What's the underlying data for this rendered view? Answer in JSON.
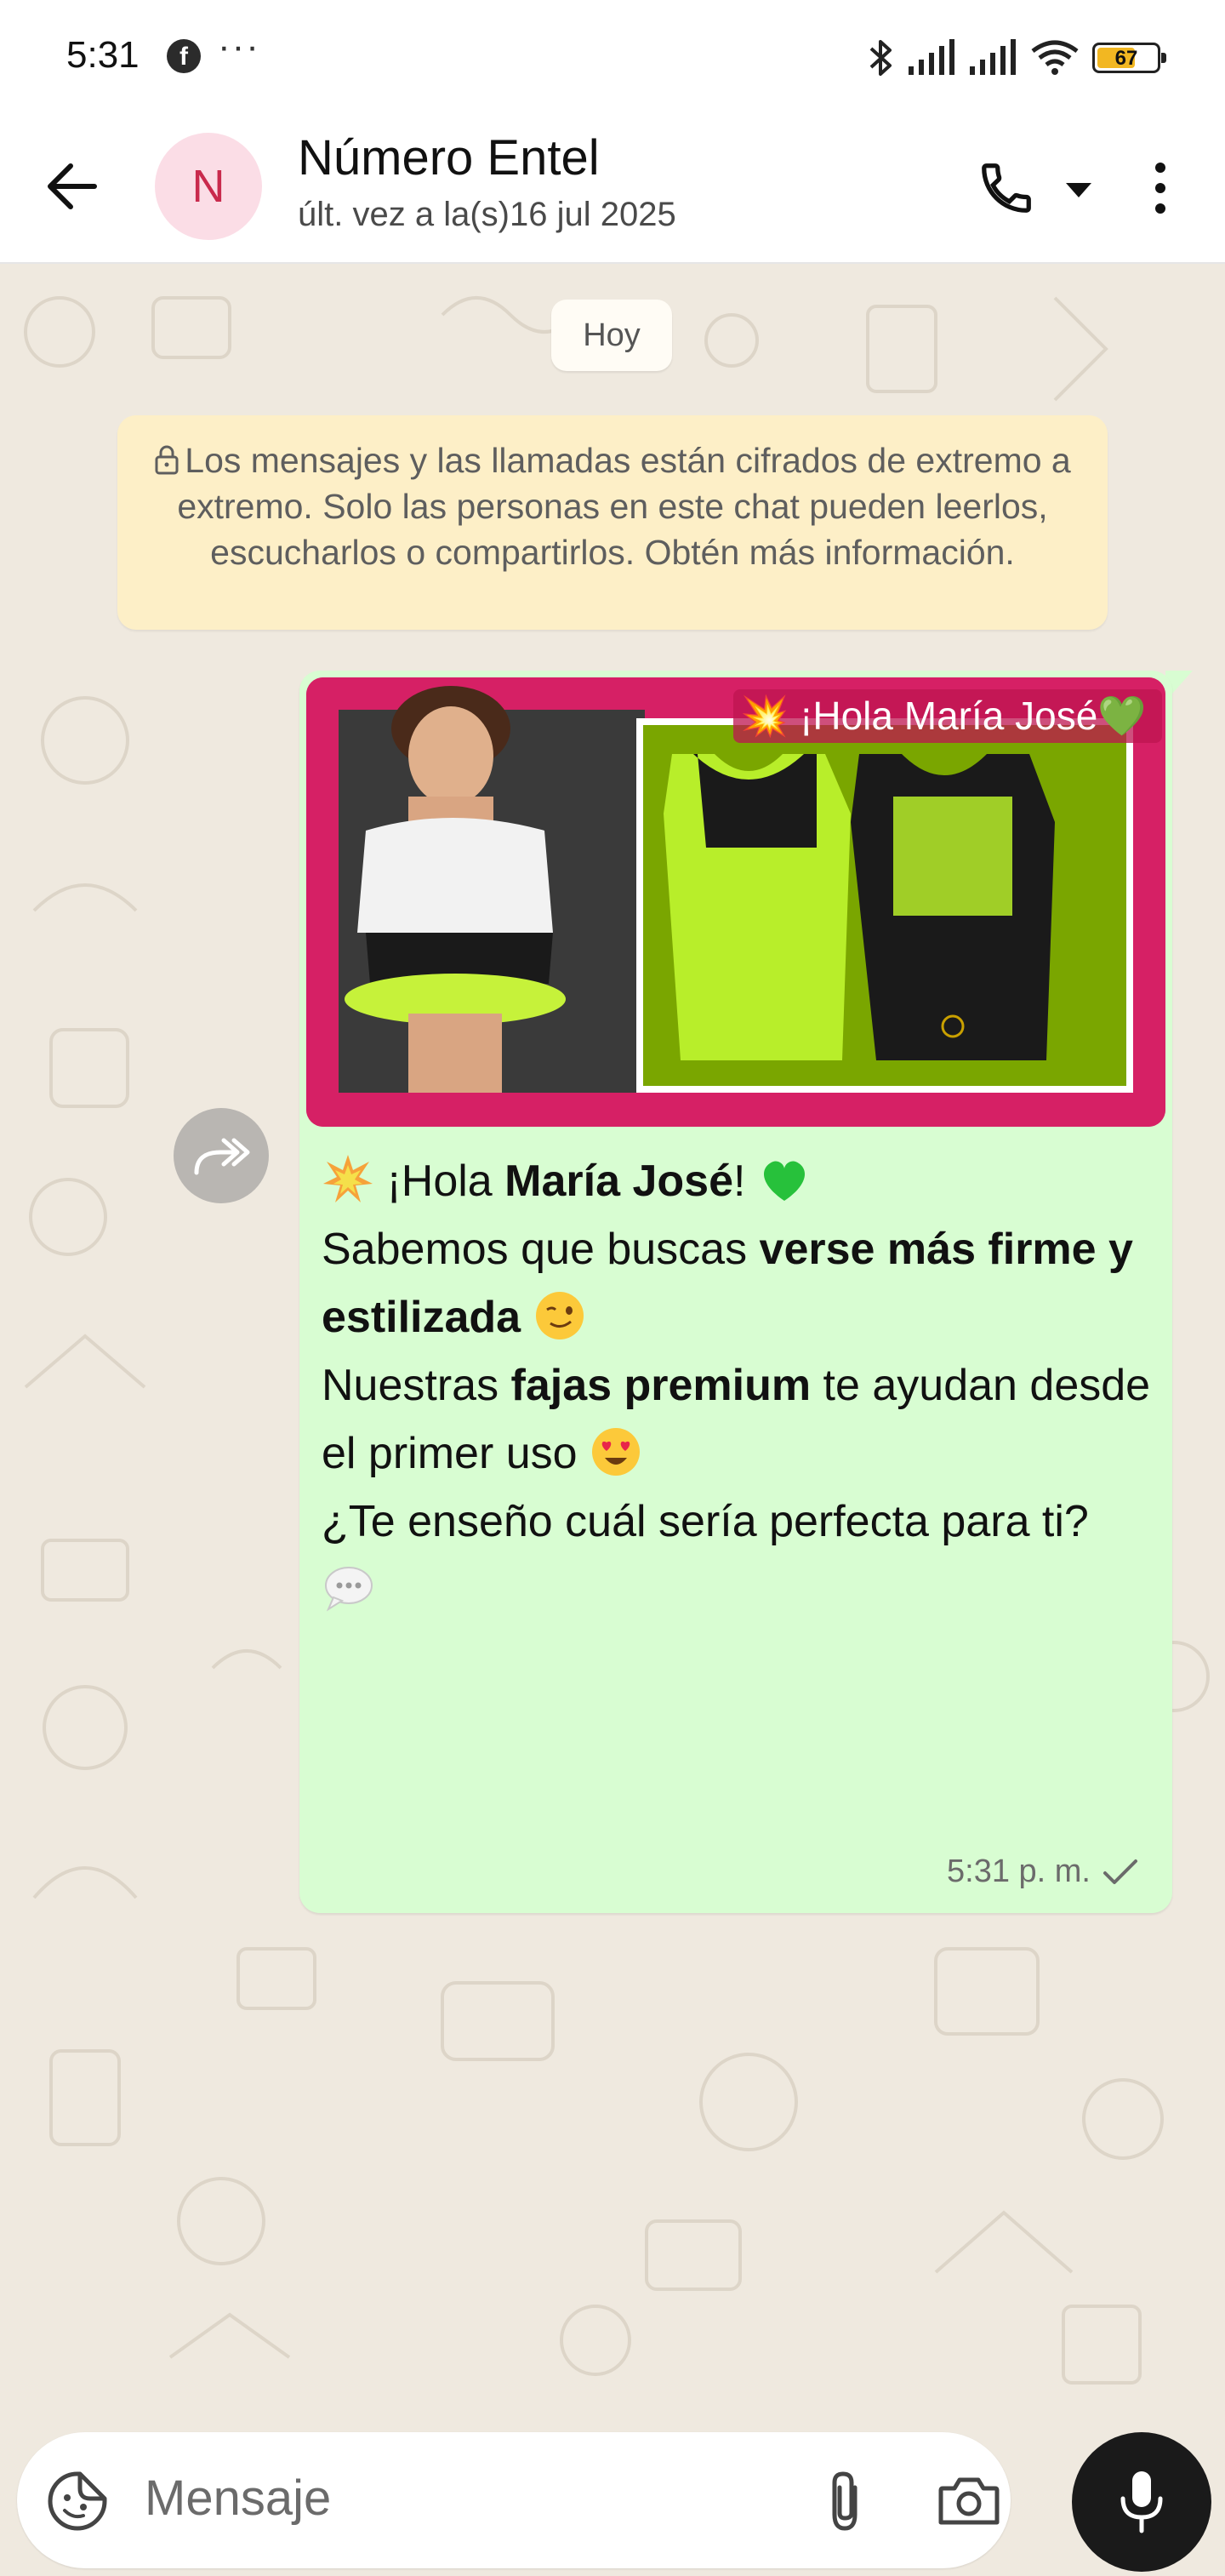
{
  "status_bar": {
    "time": "5:31",
    "app_icon": "facebook-icon",
    "more_dots": "···",
    "battery_level": 67,
    "battery_label": "67",
    "icons": [
      "bluetooth-icon",
      "signal-icon",
      "signal-icon",
      "wifi-icon",
      "battery-icon"
    ]
  },
  "header": {
    "avatar_letter": "N",
    "contact_name": "Número Entel",
    "last_seen": "últ. vez a la(s)16 jul 2025"
  },
  "chat": {
    "date_chip": "Hoy",
    "encryption_notice": "Los mensajes y las llamadas están cifrados de extremo a extremo. Solo las personas en este chat pueden leerlos, escucharlos o compartirlos. Obtén más información.",
    "message": {
      "image_caption": "¡Hola María José",
      "line1_pre": "¡Hola ",
      "line1_bold": "María José",
      "line1_post": "!",
      "line2_pre": "Sabemos que buscas ",
      "line2_bold": "verse más firme y estilizada",
      "line3_pre": "Nuestras ",
      "line3_bold": "fajas premium",
      "line3_post": " te ayudan desde el primer uso",
      "line4": "¿Te enseño cuál sería perfecta para ti?",
      "time": "5:31 p. m.",
      "status": "sent"
    }
  },
  "input": {
    "placeholder": "Mensaje"
  },
  "colors": {
    "bubble": "#d8fdd2",
    "notice": "#fdefc7",
    "chat_bg": "#efe9df",
    "avatar_bg": "#fbdde6",
    "avatar_text": "#c92a4d",
    "mic_bg": "#1a1a1a"
  }
}
